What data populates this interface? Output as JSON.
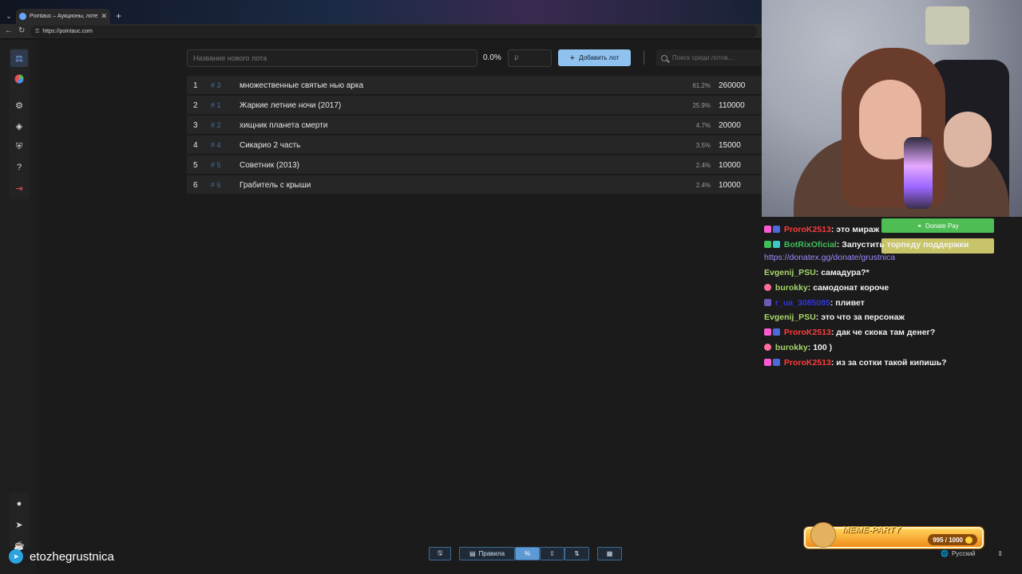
{
  "browser": {
    "tab_title": "Pointauc – Аукционы, лотереи и …",
    "url": "https://pointauc.com"
  },
  "controls": {
    "lot_name_placeholder": "Название нового лота",
    "percent": "0.0%",
    "amount_placeholder": "₽",
    "add_button": "Добавить лот",
    "search_placeholder": "Поиск среди лотов..."
  },
  "lots": [
    {
      "n": "1",
      "id": "# 3",
      "name": "множественные святые нью арка",
      "pct": "61.2%",
      "amount": "260000"
    },
    {
      "n": "2",
      "id": "# 1",
      "name": "Жаркие летние ночи (2017)",
      "pct": "25.9%",
      "amount": "110000"
    },
    {
      "n": "3",
      "id": "# 2",
      "name": "хищник планета смерти",
      "pct": "4.7%",
      "amount": "20000"
    },
    {
      "n": "4",
      "id": "# 4",
      "name": "Сикарио 2 часть",
      "pct": "3.5%",
      "amount": "15000"
    },
    {
      "n": "5",
      "id": "# 5",
      "name": "Советник (2013)",
      "pct": "2.4%",
      "amount": "10000"
    },
    {
      "n": "6",
      "id": "# 6",
      "name": "Грабитель с крыши",
      "pct": "2.4%",
      "amount": "10000"
    }
  ],
  "toolbar": {
    "rules_label": "Правила"
  },
  "chat": {
    "donate_pay": "Donate Pay",
    "messages": [
      {
        "user": "ProroK2513",
        "color": "#ff3b3b",
        "text": ": это мираж"
      },
      {
        "user": "BotRixOficial",
        "color": "#3fbf5c",
        "text": ": Запустить торпеду поддержки"
      },
      {
        "user": "Evgenij_PSU",
        "color": "#a8d66b",
        "text": ": самадура?*"
      },
      {
        "user": "burokky",
        "color": "#a8d66b",
        "text": ": самодонат короче"
      },
      {
        "user": "r_ua_3085085",
        "color": "#2f36d9",
        "text": ": пливет"
      },
      {
        "user": "Evgenij_PSU",
        "color": "#a8d66b",
        "text": ": это что за персонаж"
      },
      {
        "user": "ProroK2513",
        "color": "#ff3b3b",
        "text": ": дак че скока там денег?"
      },
      {
        "user": "burokky",
        "color": "#a8d66b",
        "text": ": 100 )"
      },
      {
        "user": "ProroK2513",
        "color": "#ff3b3b",
        "text": ": из за сотки такой кипишь?"
      }
    ],
    "link": "https://donatex.gg/donate/grustnica"
  },
  "overlay": {
    "meme_title": "MEME-PARTY",
    "meme_count": "995 / 1000",
    "language": "Русский",
    "streamer": "etozhegrustnica"
  },
  "colors": {
    "accent": "#90c2f0",
    "donate_green": "#4dbd54"
  }
}
